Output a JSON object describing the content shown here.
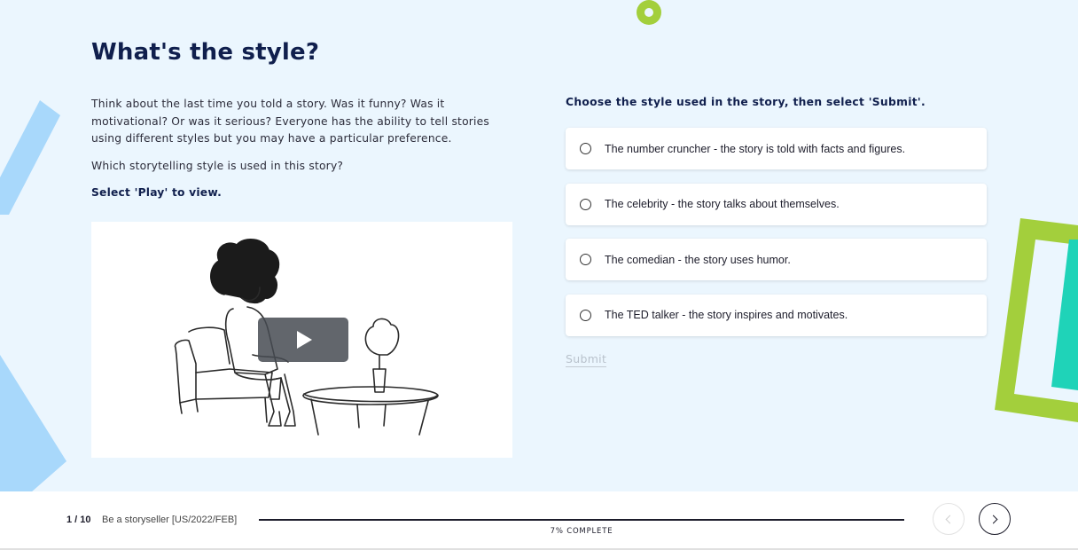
{
  "title": "What's the style?",
  "intro": {
    "paragraph": "Think about the last time you told a story. Was it funny? Was it motivational? Or was it serious? Everyone has the ability to tell stories using different styles but you may have a particular preference.",
    "question": "Which storytelling style is used in this story?",
    "instruction": "Select 'Play' to view."
  },
  "quiz": {
    "prompt": "Choose the style used in the story, then select 'Submit'.",
    "options": [
      "The number cruncher - the story is told with facts and figures.",
      "The celebrity - the story talks about themselves.",
      "The comedian - the story uses humor.",
      "The TED talker - the story inspires and motivates."
    ],
    "submit_label": "Submit"
  },
  "footer": {
    "page": "1 / 10",
    "course": "Be a storyseller [US/2022/FEB]",
    "progress_label": "7% COMPLETE",
    "progress_value": 0.07
  },
  "colors": {
    "background": "#ebf6fe",
    "title": "#101f4d",
    "accent_green": "#a3cf3c",
    "accent_teal": "#1fd3b8",
    "accent_blue": "#a8d8fb"
  },
  "icons": {
    "play": "play-icon",
    "prev": "chevron-left-icon",
    "next": "chevron-right-icon"
  }
}
